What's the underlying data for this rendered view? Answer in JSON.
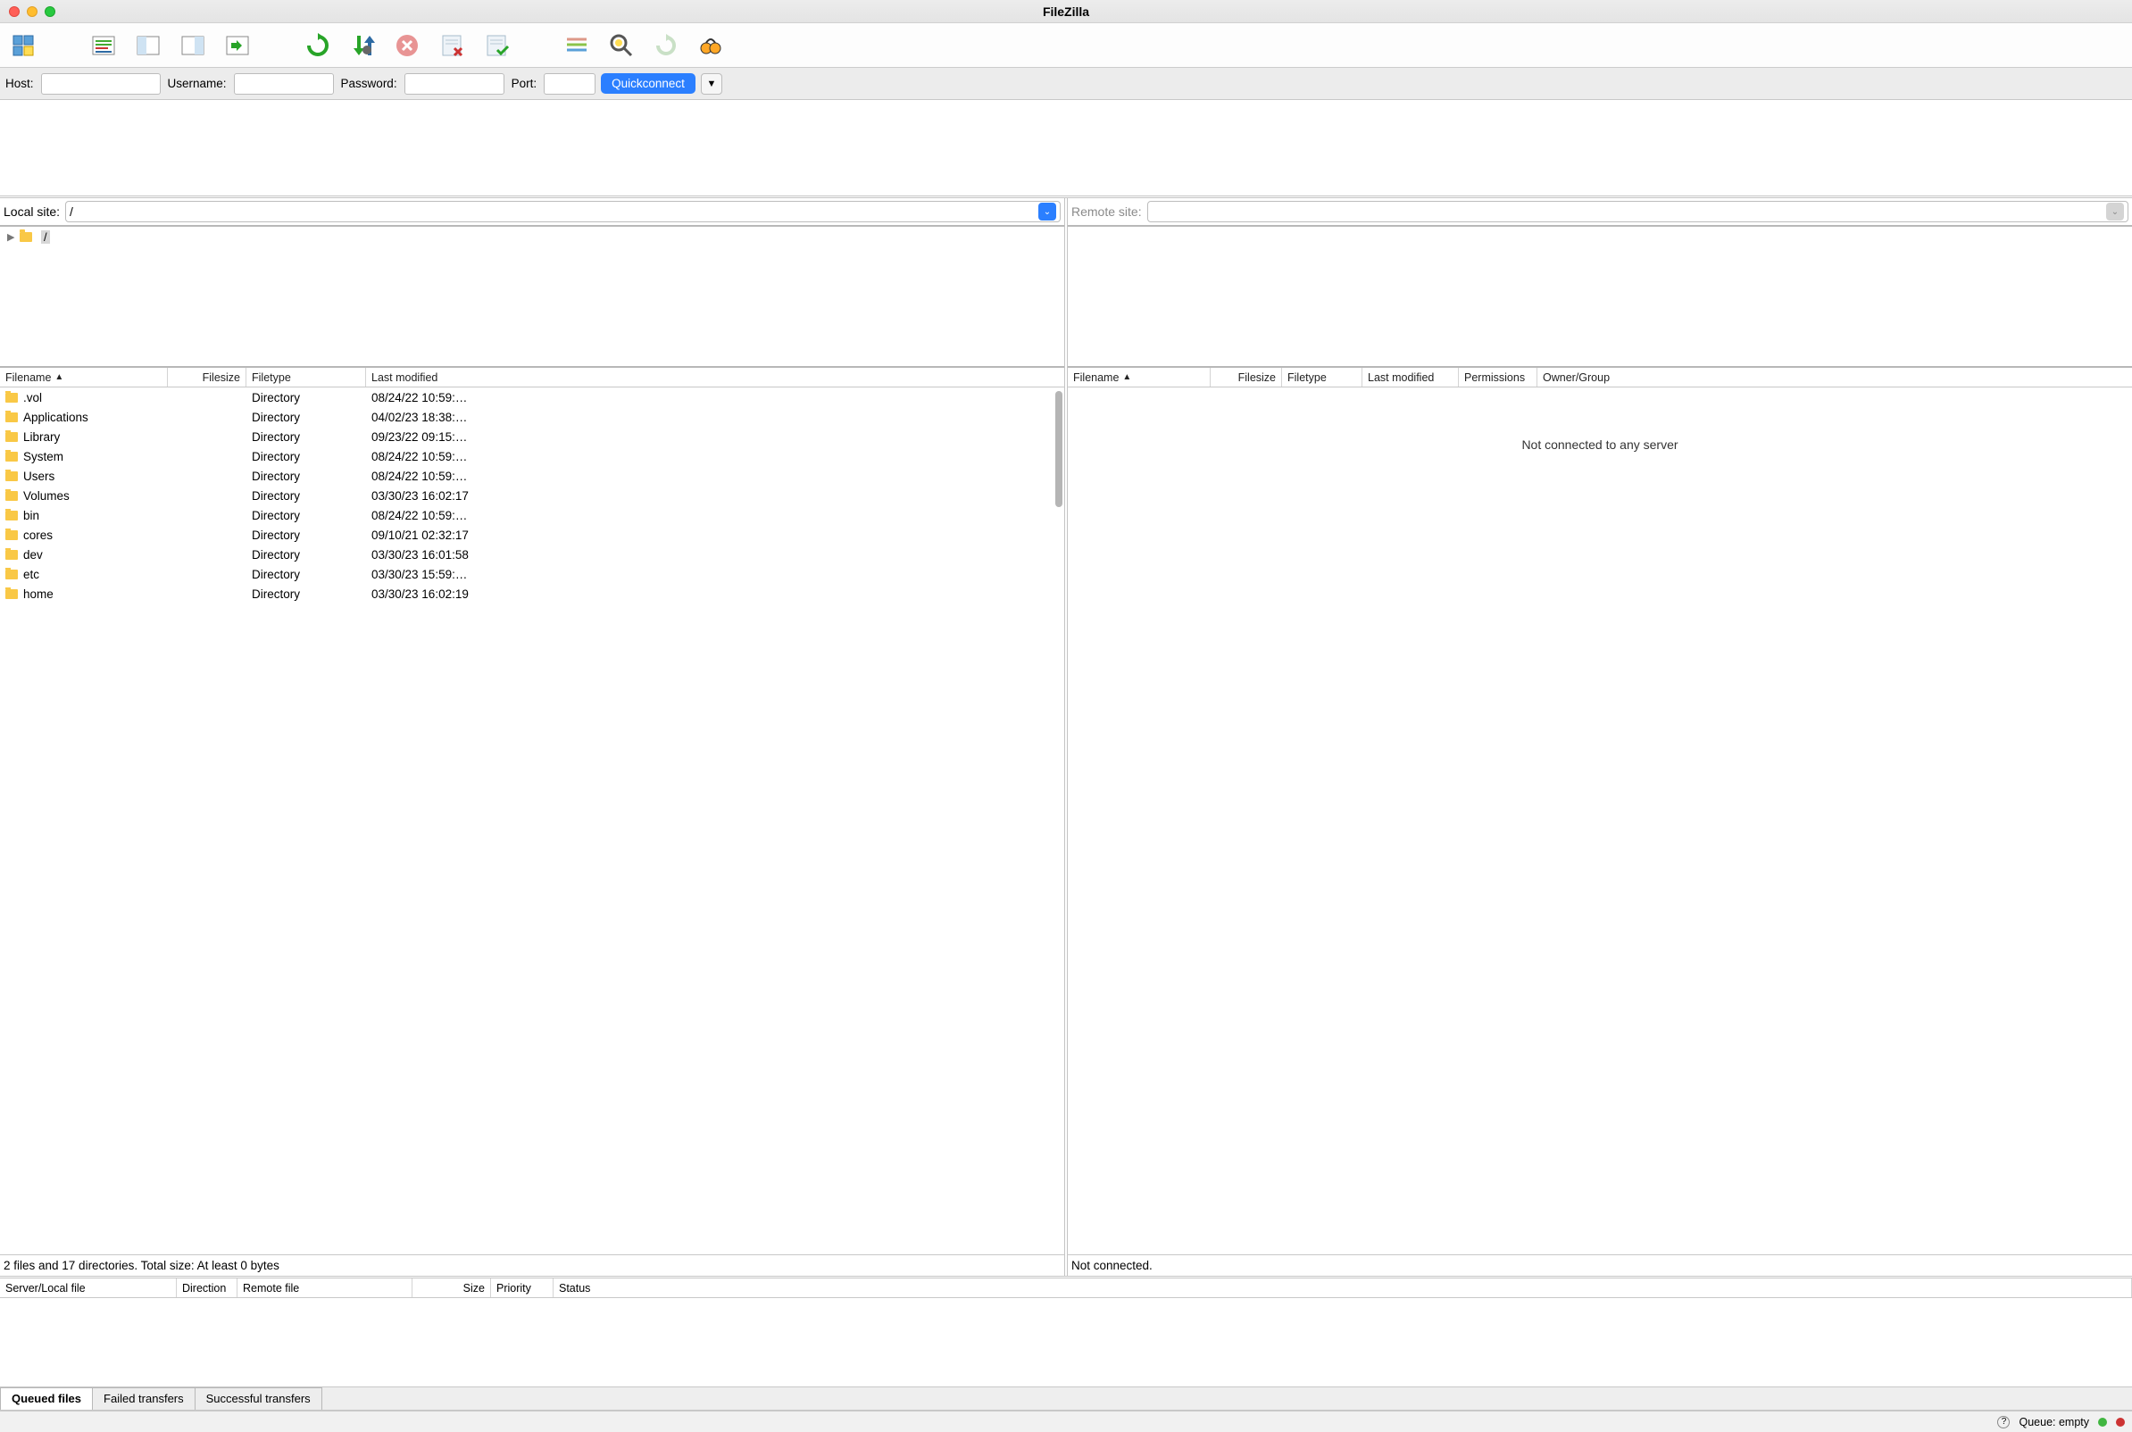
{
  "title": "FileZilla",
  "quickconnect": {
    "host_label": "Host:",
    "username_label": "Username:",
    "password_label": "Password:",
    "port_label": "Port:",
    "button": "Quickconnect"
  },
  "local": {
    "label": "Local site:",
    "path": "/",
    "tree_root_label": "/",
    "columns": {
      "name": "Filename",
      "size": "Filesize",
      "type": "Filetype",
      "modified": "Last modified"
    },
    "files": [
      {
        "name": ".vol",
        "size": "",
        "type": "Directory",
        "modified": "08/24/22 10:59:…"
      },
      {
        "name": "Applications",
        "size": "",
        "type": "Directory",
        "modified": "04/02/23 18:38:…"
      },
      {
        "name": "Library",
        "size": "",
        "type": "Directory",
        "modified": "09/23/22 09:15:…"
      },
      {
        "name": "System",
        "size": "",
        "type": "Directory",
        "modified": "08/24/22 10:59:…"
      },
      {
        "name": "Users",
        "size": "",
        "type": "Directory",
        "modified": "08/24/22 10:59:…"
      },
      {
        "name": "Volumes",
        "size": "",
        "type": "Directory",
        "modified": "03/30/23 16:02:17"
      },
      {
        "name": "bin",
        "size": "",
        "type": "Directory",
        "modified": "08/24/22 10:59:…"
      },
      {
        "name": "cores",
        "size": "",
        "type": "Directory",
        "modified": "09/10/21 02:32:17"
      },
      {
        "name": "dev",
        "size": "",
        "type": "Directory",
        "modified": "03/30/23 16:01:58"
      },
      {
        "name": "etc",
        "size": "",
        "type": "Directory",
        "modified": "03/30/23 15:59:…"
      },
      {
        "name": "home",
        "size": "",
        "type": "Directory",
        "modified": "03/30/23 16:02:19"
      }
    ],
    "summary": "2 files and 17 directories. Total size: At least 0 bytes"
  },
  "remote": {
    "label": "Remote site:",
    "columns": {
      "name": "Filename",
      "size": "Filesize",
      "type": "Filetype",
      "modified": "Last modified",
      "permissions": "Permissions",
      "owner": "Owner/Group"
    },
    "empty": "Not connected to any server",
    "summary": "Not connected."
  },
  "queue": {
    "columns": {
      "server": "Server/Local file",
      "direction": "Direction",
      "remote": "Remote file",
      "size": "Size",
      "priority": "Priority",
      "status": "Status"
    },
    "tabs": {
      "queued": "Queued files",
      "failed": "Failed transfers",
      "successful": "Successful transfers"
    }
  },
  "statusbar": {
    "queue": "Queue: empty"
  },
  "icons": {
    "site_manager": "site-manager-icon",
    "toggle_log": "toggle-log-icon",
    "toggle_local_tree": "toggle-local-tree-icon",
    "toggle_remote_tree": "toggle-remote-tree-icon",
    "toggle_queue": "toggle-queue-icon",
    "refresh": "refresh-icon",
    "process_queue": "process-queue-icon",
    "cancel": "cancel-icon",
    "disconnect": "disconnect-icon",
    "reconnect": "reconnect-icon",
    "directory_listing": "directory-listing-icon",
    "filter": "filter-icon",
    "compare": "compare-icon",
    "sync_browse": "sync-browse-icon",
    "search": "search-icon"
  }
}
